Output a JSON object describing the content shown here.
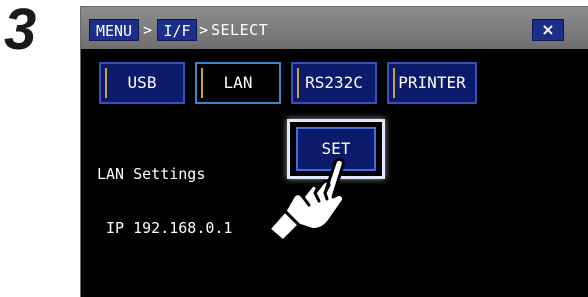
{
  "step": {
    "number": "3"
  },
  "titlebar": {
    "menu_label": "MENU",
    "separator": ">",
    "if_label": "I/F",
    "current": "SELECT",
    "close_label": "×"
  },
  "tabs": [
    {
      "label": "USB",
      "selected": false
    },
    {
      "label": "LAN",
      "selected": true
    },
    {
      "label": "RS232C",
      "selected": false
    },
    {
      "label": "PRINTER",
      "selected": false
    }
  ],
  "info": {
    "title": "LAN Settings",
    "ip_line": " IP 192.168.0.1"
  },
  "set_button": {
    "label": "SET"
  },
  "icons": {
    "pointer": "pointing-hand-icon",
    "close": "close-icon"
  },
  "colors": {
    "screen_bg": "#000000",
    "titlebar": "#7e7e7e",
    "button_blue": "#0b1a6b",
    "button_border": "#3a4fb8",
    "selected_border": "#3a84c8"
  }
}
